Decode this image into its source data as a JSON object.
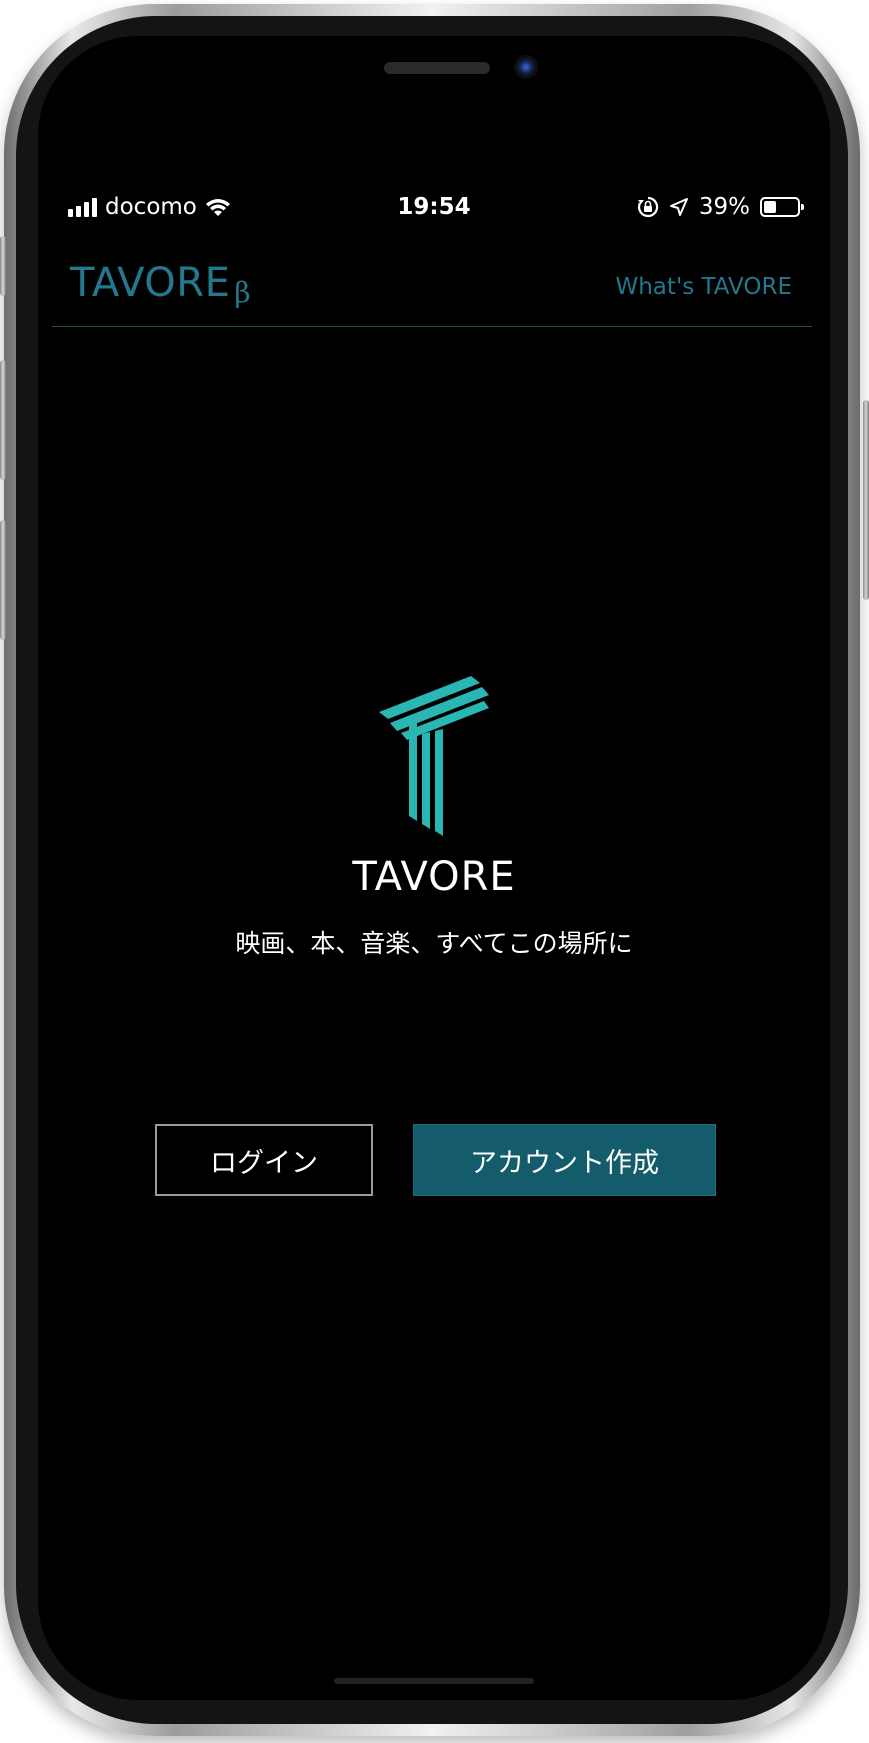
{
  "status_bar": {
    "carrier": "docomo",
    "time": "19:54",
    "battery_percent": "39%",
    "battery_level": 0.39
  },
  "nav": {
    "brand": "TAVORE",
    "beta": "β",
    "whats_link": "What's TAVORE"
  },
  "hero": {
    "title": "TAVORE",
    "tagline": "映画、本、音楽、すべてこの場所に"
  },
  "actions": {
    "login_label": "ログイン",
    "signup_label": "アカウント作成"
  },
  "colors": {
    "brand_teal": "#23788e",
    "logo_teal": "#2ab6b2",
    "signup_bg": "#145b6b",
    "background": "#000000"
  },
  "icons": [
    "signal-icon",
    "wifi-icon",
    "orientation-lock-icon",
    "location-arrow-icon",
    "battery-icon",
    "tavore-logo-icon"
  ]
}
